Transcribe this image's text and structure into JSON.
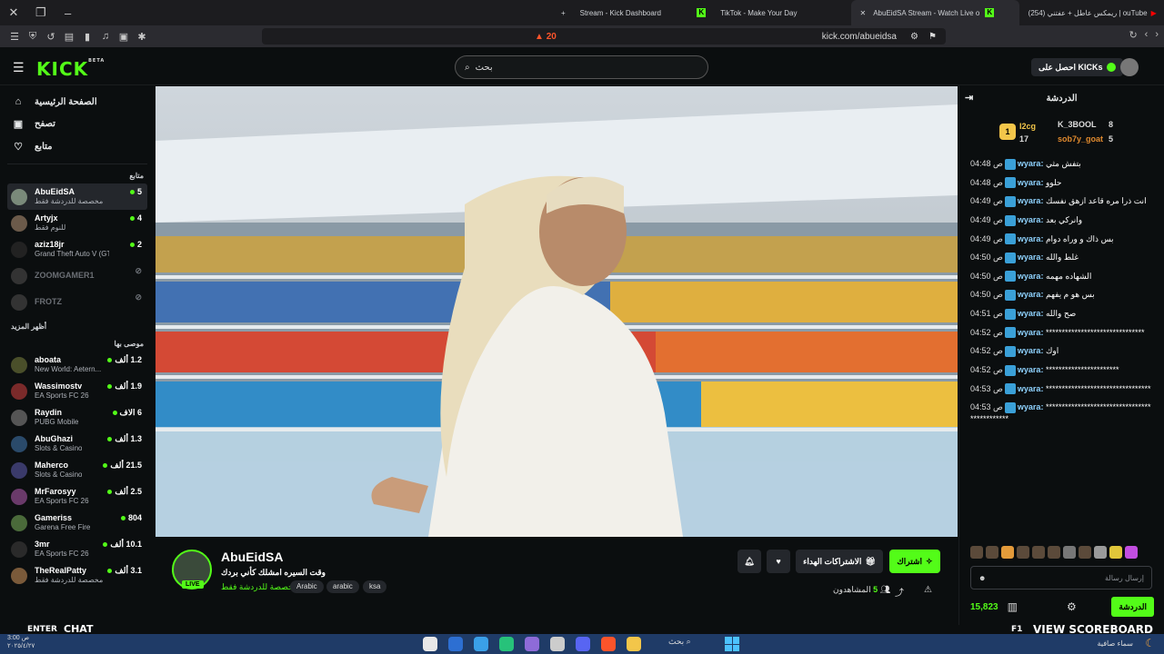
{
  "browser": {
    "tabs": [
      {
        "label": "Stream - Kick Dashboard",
        "icon": "plus-icon"
      },
      {
        "label": "TikTok - Make Your Day",
        "icon": "kick-icon"
      },
      {
        "label": "AbuEidSA Stream - Watch Live o",
        "icon": "tiktok-icon",
        "active": true
      },
      {
        "label": "(254) ريمكس عاطل + عفتني | ouTube",
        "icon": "youtube-icon"
      }
    ],
    "url": "kick.com/abueidsa",
    "brave_badge": "20"
  },
  "header": {
    "logo": "KICK",
    "logo_badge": "BETA",
    "search_placeholder": "بحث",
    "get_kicks": "احصل على KICKs"
  },
  "sidebar": {
    "nav": [
      {
        "label": "الصفحة الرئيسية",
        "icon": "home-icon"
      },
      {
        "label": "تصفح",
        "icon": "browse-icon"
      },
      {
        "label": "متابع",
        "icon": "heart-icon"
      }
    ],
    "following_title": "متابع",
    "following": [
      {
        "name": "AbuEidSA",
        "category": "مخصصة للدردشة فقط",
        "viewers": "5",
        "selected": true
      },
      {
        "name": "Artyjx",
        "category": "للنوم فقط",
        "viewers": "4"
      },
      {
        "name": "aziz18jr",
        "category": "Grand Theft Auto V (GTA)",
        "viewers": "2"
      },
      {
        "name": "ZOOMGAMER1",
        "offline": true
      },
      {
        "name": "FROTZ",
        "offline": true
      }
    ],
    "show_more": "أظهر المزيد",
    "recommended_title": "موصى بها",
    "recommended": [
      {
        "name": "aboata",
        "category": "New World: Aetern...",
        "viewers": "1.2 ألف"
      },
      {
        "name": "Wassimostv",
        "category": "EA Sports FC 26",
        "viewers": "1.9 ألف"
      },
      {
        "name": "Raydin",
        "category": "PUBG Mobile",
        "viewers": "6 الاف"
      },
      {
        "name": "AbuGhazi",
        "category": "Slots & Casino",
        "viewers": "1.3 ألف"
      },
      {
        "name": "Maherco",
        "category": "Slots & Casino",
        "viewers": "21.5 ألف"
      },
      {
        "name": "MrFarosyy",
        "category": "EA Sports FC 26",
        "viewers": "2.5 ألف"
      },
      {
        "name": "Gameriss",
        "category": "Garena Free Fire",
        "viewers": "804"
      },
      {
        "name": "3mr",
        "category": "EA Sports FC 26",
        "viewers": "10.1 ألف"
      },
      {
        "name": "TheRealPatty",
        "category": "مخصصة للدردشة فقط",
        "viewers": "3.1 ألف"
      }
    ]
  },
  "stream": {
    "name": "AbuEidSA",
    "live": "LIVE",
    "title": "وقت السيره امشلك كأني بردك",
    "category": "مخصصة للدردشة فقط",
    "tags": [
      "Arabic",
      "arabic",
      "ksa"
    ],
    "subscribe": "اشتراك",
    "gift_subs": "الاشتراكات الهداء",
    "viewers_label": "المشاهدون",
    "viewers": "5"
  },
  "chat": {
    "title": "الدردشة",
    "leaderboard": [
      {
        "name": "I2cg",
        "count": "17"
      },
      {
        "name": "K_3BOOL",
        "count": "8"
      },
      {
        "name": "sob7y_goat",
        "count": "5"
      }
    ],
    "messages": [
      {
        "time": "04:48 ص",
        "user": "wyara",
        "text": "بتفش مثي"
      },
      {
        "time": "04:48 ص",
        "user": "wyara",
        "text": "حلوو"
      },
      {
        "time": "04:49 ص",
        "user": "wyara",
        "text": "انت ذرا مره قاعد ازهق نفسك"
      },
      {
        "time": "04:49 ص",
        "user": "wyara",
        "text": "وانركي بعد"
      },
      {
        "time": "04:49 ص",
        "user": "wyara",
        "text": "بس ذاك و وراه دوام"
      },
      {
        "time": "04:50 ص",
        "user": "wyara",
        "text": "غلط والله"
      },
      {
        "time": "04:50 ص",
        "user": "wyara",
        "text": "الشهاده مهمه"
      },
      {
        "time": "04:50 ص",
        "user": "wyara",
        "text": "بس هو م يفهم"
      },
      {
        "time": "04:51 ص",
        "user": "wyara",
        "text": "صح والله"
      },
      {
        "time": "04:52 ص",
        "user": "wyara",
        "text": "*******************************"
      },
      {
        "time": "04:52 ص",
        "user": "wyara",
        "text": "اوك"
      },
      {
        "time": "04:52 ص",
        "user": "wyara",
        "text": "***********************"
      },
      {
        "time": "04:53 ص",
        "user": "wyara",
        "text": "*********************************"
      },
      {
        "time": "04:53 ص",
        "user": "wyara",
        "text": "*********************************************"
      }
    ],
    "input_placeholder": "إرسال رسالة",
    "points": "15,823",
    "chat_button": "الدردشة"
  },
  "overlay": {
    "enter_label": "ENTER",
    "chat_label": "CHAT",
    "f1_label": "F1",
    "scoreboard": "VIEW SCOREBOARD"
  },
  "taskbar": {
    "time": "3:00 ص",
    "date": "٢٠٢٥/٤/٢٧",
    "search": "بحث",
    "weather": "سماء صافية"
  }
}
